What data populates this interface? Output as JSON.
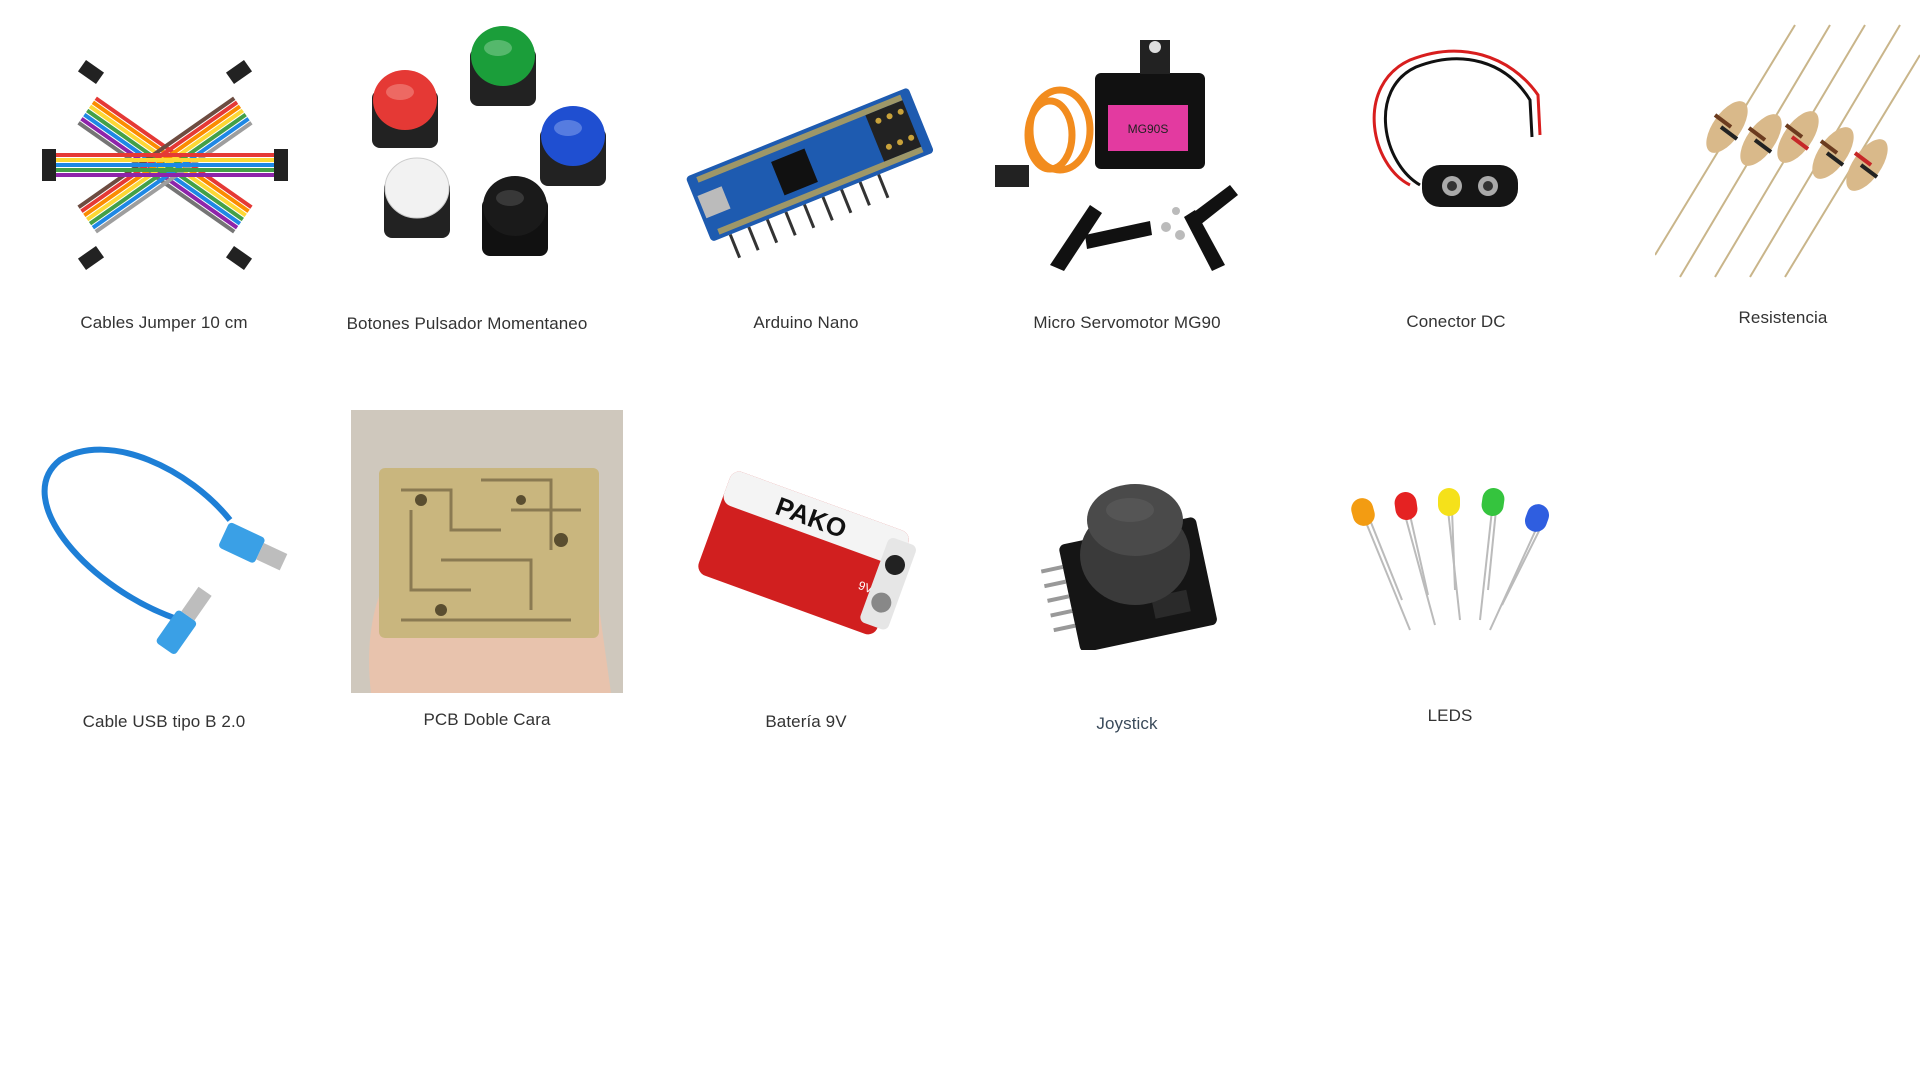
{
  "products": [
    {
      "id": "jumper",
      "label": "Cables Jumper 10 cm",
      "icon": "jumper-wires-image"
    },
    {
      "id": "buttons",
      "label": "Botones Pulsador Momentaneo",
      "icon": "push-buttons-image"
    },
    {
      "id": "nano",
      "label": "Arduino Nano",
      "icon": "arduino-nano-image"
    },
    {
      "id": "servo",
      "label": "Micro Servomotor MG90",
      "icon": "servo-motor-image"
    },
    {
      "id": "dc",
      "label": "Conector DC",
      "icon": "dc-connector-image"
    },
    {
      "id": "resistor",
      "label": "Resistencia",
      "icon": "resistors-image"
    },
    {
      "id": "usb",
      "label": "Cable USB tipo B  2.0",
      "icon": "usb-cable-image"
    },
    {
      "id": "pcb",
      "label": "PCB Doble Cara",
      "icon": "pcb-image"
    },
    {
      "id": "battery",
      "label": "Batería 9V",
      "icon": "battery-image"
    },
    {
      "id": "joystick",
      "label": "Joystick",
      "icon": "joystick-image"
    },
    {
      "id": "leds",
      "label": "LEDS",
      "icon": "leds-image"
    }
  ],
  "image_text": {
    "battery_brand": "PAKO",
    "battery_volt": "9V",
    "servo_model": "MG90S"
  }
}
